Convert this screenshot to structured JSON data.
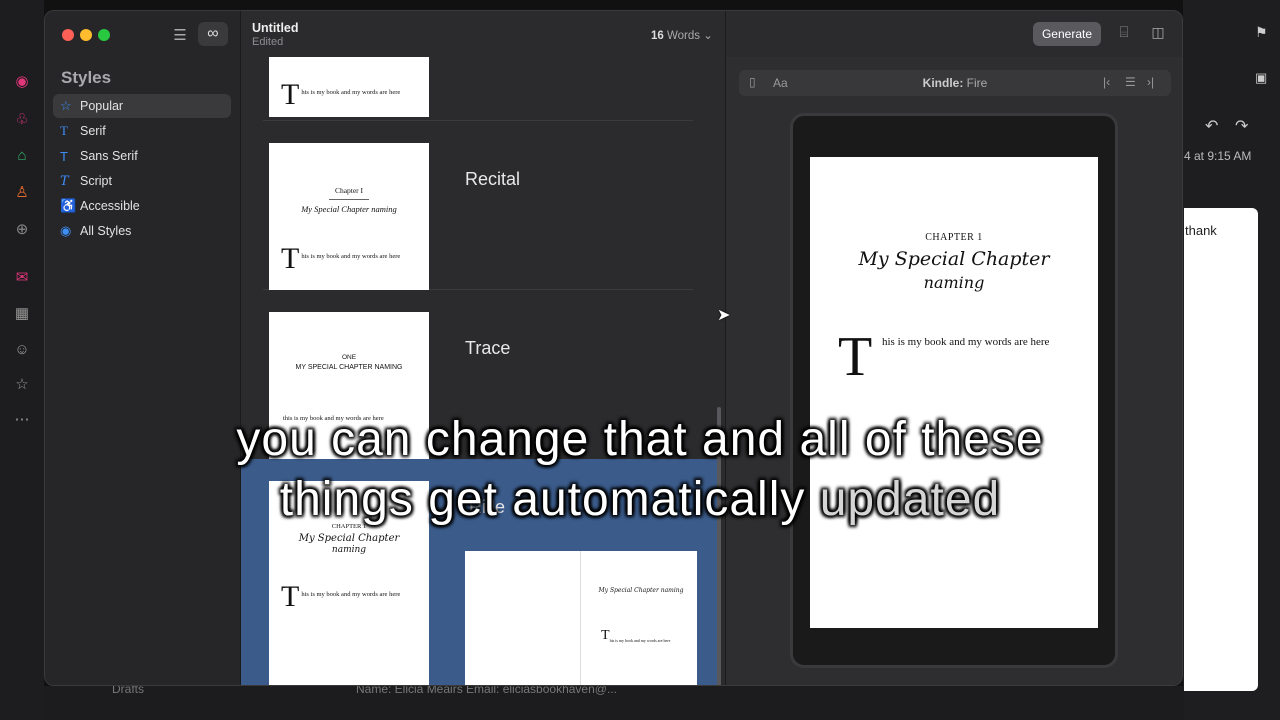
{
  "background": {
    "right_time": "4 at 9:15 AM",
    "right_text": "thank",
    "drafts": "Drafts",
    "email_snippet": "Name: Elicia Meairs Email: eliciasbookhaven@..."
  },
  "sidebar": {
    "title": "Styles",
    "items": [
      {
        "label": "Popular",
        "icon": "☆"
      },
      {
        "label": "Serif",
        "icon": "T"
      },
      {
        "label": "Sans Serif",
        "icon": "T"
      },
      {
        "label": "Script",
        "icon": "T"
      },
      {
        "label": "Accessible",
        "icon": "♿"
      },
      {
        "label": "All Styles",
        "icon": "◉"
      }
    ]
  },
  "header": {
    "title": "Untitled",
    "subtitle": "Edited",
    "word_count_number": "16",
    "word_count_label": "Words ⌄",
    "generate": "Generate"
  },
  "styles": {
    "thumb_body": "his is my book and my words are here",
    "dropcap": "T",
    "recital": {
      "name": "Recital",
      "chapter": "Chapter I",
      "subtitle": "My Special Chapter naming"
    },
    "trace": {
      "name": "Trace",
      "chapter": "ONE",
      "subtitle": "MY SPECIAL CHAPTER NAMING",
      "body": "this is my book and my words are here"
    },
    "selected": {
      "name": "Rifle",
      "chapter": "CHAPTER 1",
      "title1": "My Special Chapter",
      "title2": "naming",
      "spread_title": "My Special Chapter naming"
    }
  },
  "preview": {
    "device_label": "Kindle:",
    "device_value": "Fire",
    "chapter": "CHAPTER 1",
    "title_line1": "My Special Chapter",
    "title_line2": "naming",
    "dropcap": "T",
    "body": "his is my book and my words are here"
  },
  "caption": {
    "line1": "you can change that and all of these",
    "line2a": "things get automatically ",
    "line2b": "updated"
  },
  "colors": {
    "accent": "#3d8ef7",
    "selection": "#3b5b8a"
  }
}
